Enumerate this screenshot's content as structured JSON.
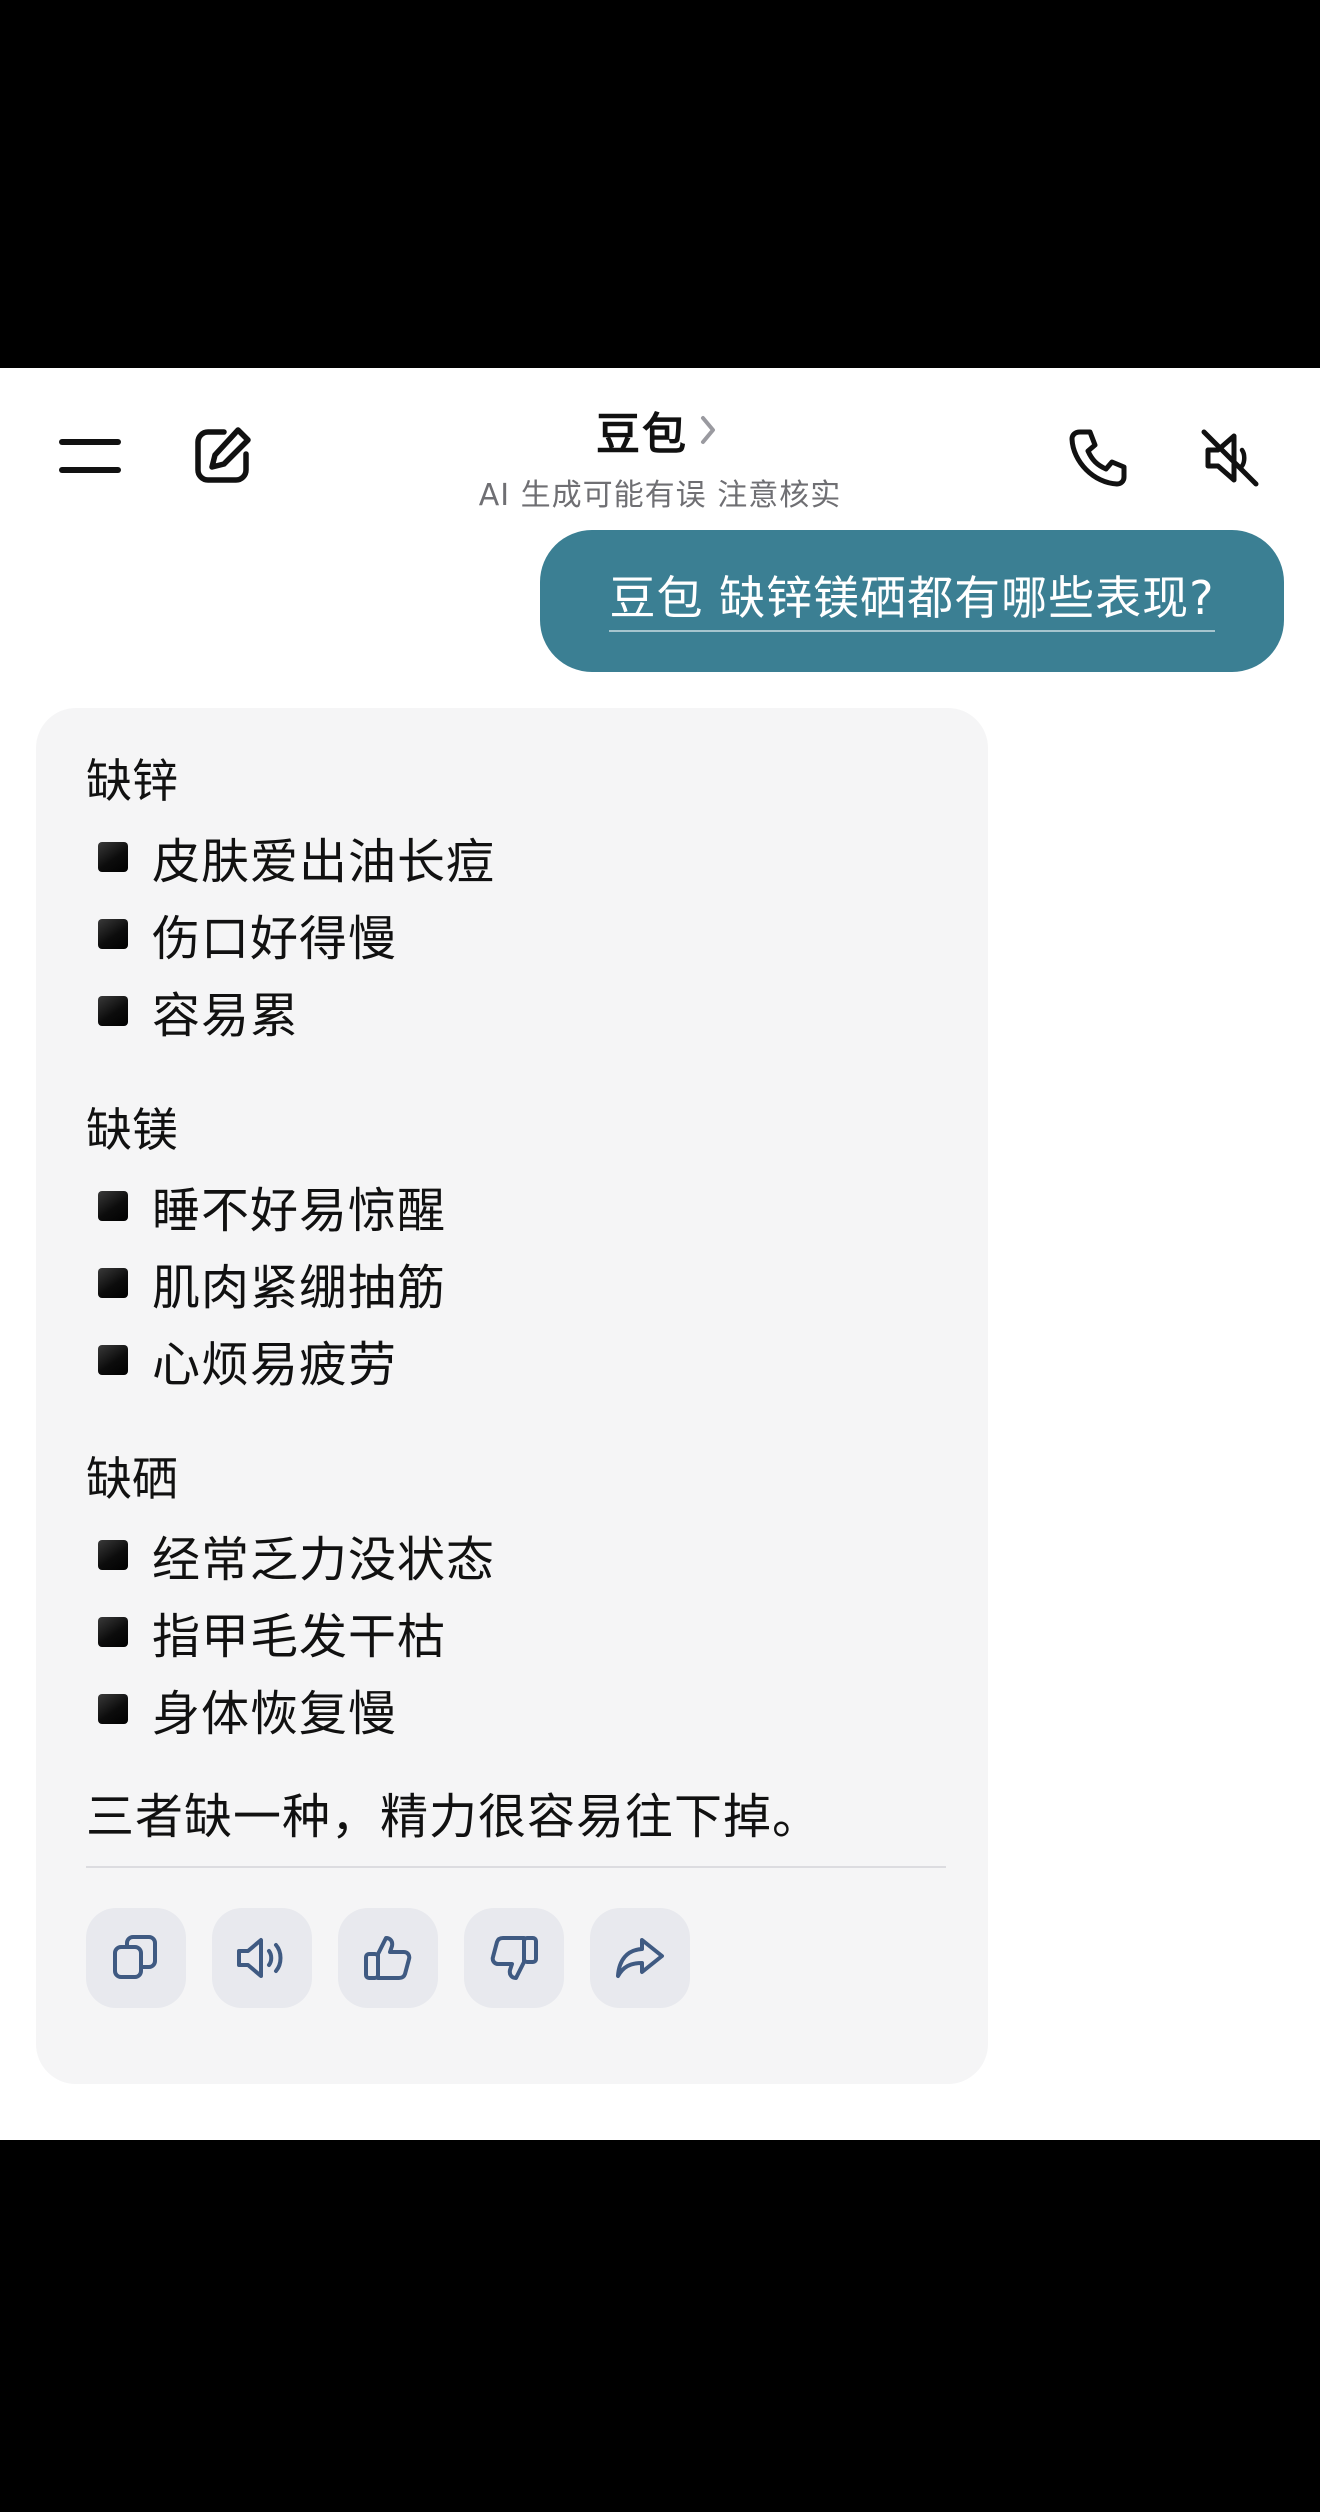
{
  "header": {
    "title": "豆包",
    "subtitle": "AI 生成可能有误 注意核实",
    "icons": [
      "menu-icon",
      "edit-icon",
      "phone-icon",
      "speaker-muted-icon"
    ]
  },
  "user_message": {
    "text": "豆包 缺锌镁硒都有哪些表现?"
  },
  "answer": {
    "sections": [
      {
        "title": "缺锌",
        "items": [
          "皮肤爱出油长痘",
          "伤口好得慢",
          "容易累"
        ]
      },
      {
        "title": "缺镁",
        "items": [
          "睡不好易惊醒",
          "肌肉紧绷抽筋",
          "心烦易疲劳"
        ]
      },
      {
        "title": "缺硒",
        "items": [
          "经常乏力没状态",
          "指甲毛发干枯",
          "身体恢复慢"
        ]
      }
    ],
    "summary": "三者缺一种，精力很容易往下掉。",
    "action_icons": [
      "copy-icon",
      "read-aloud-icon",
      "thumbs-up-icon",
      "thumbs-down-icon",
      "share-icon"
    ]
  },
  "colors": {
    "user_bubble": "#3b7f93",
    "answer_card": "#f5f5f6",
    "action_button": "#e8e9ee",
    "icon_stroke": "#3f5a82"
  }
}
